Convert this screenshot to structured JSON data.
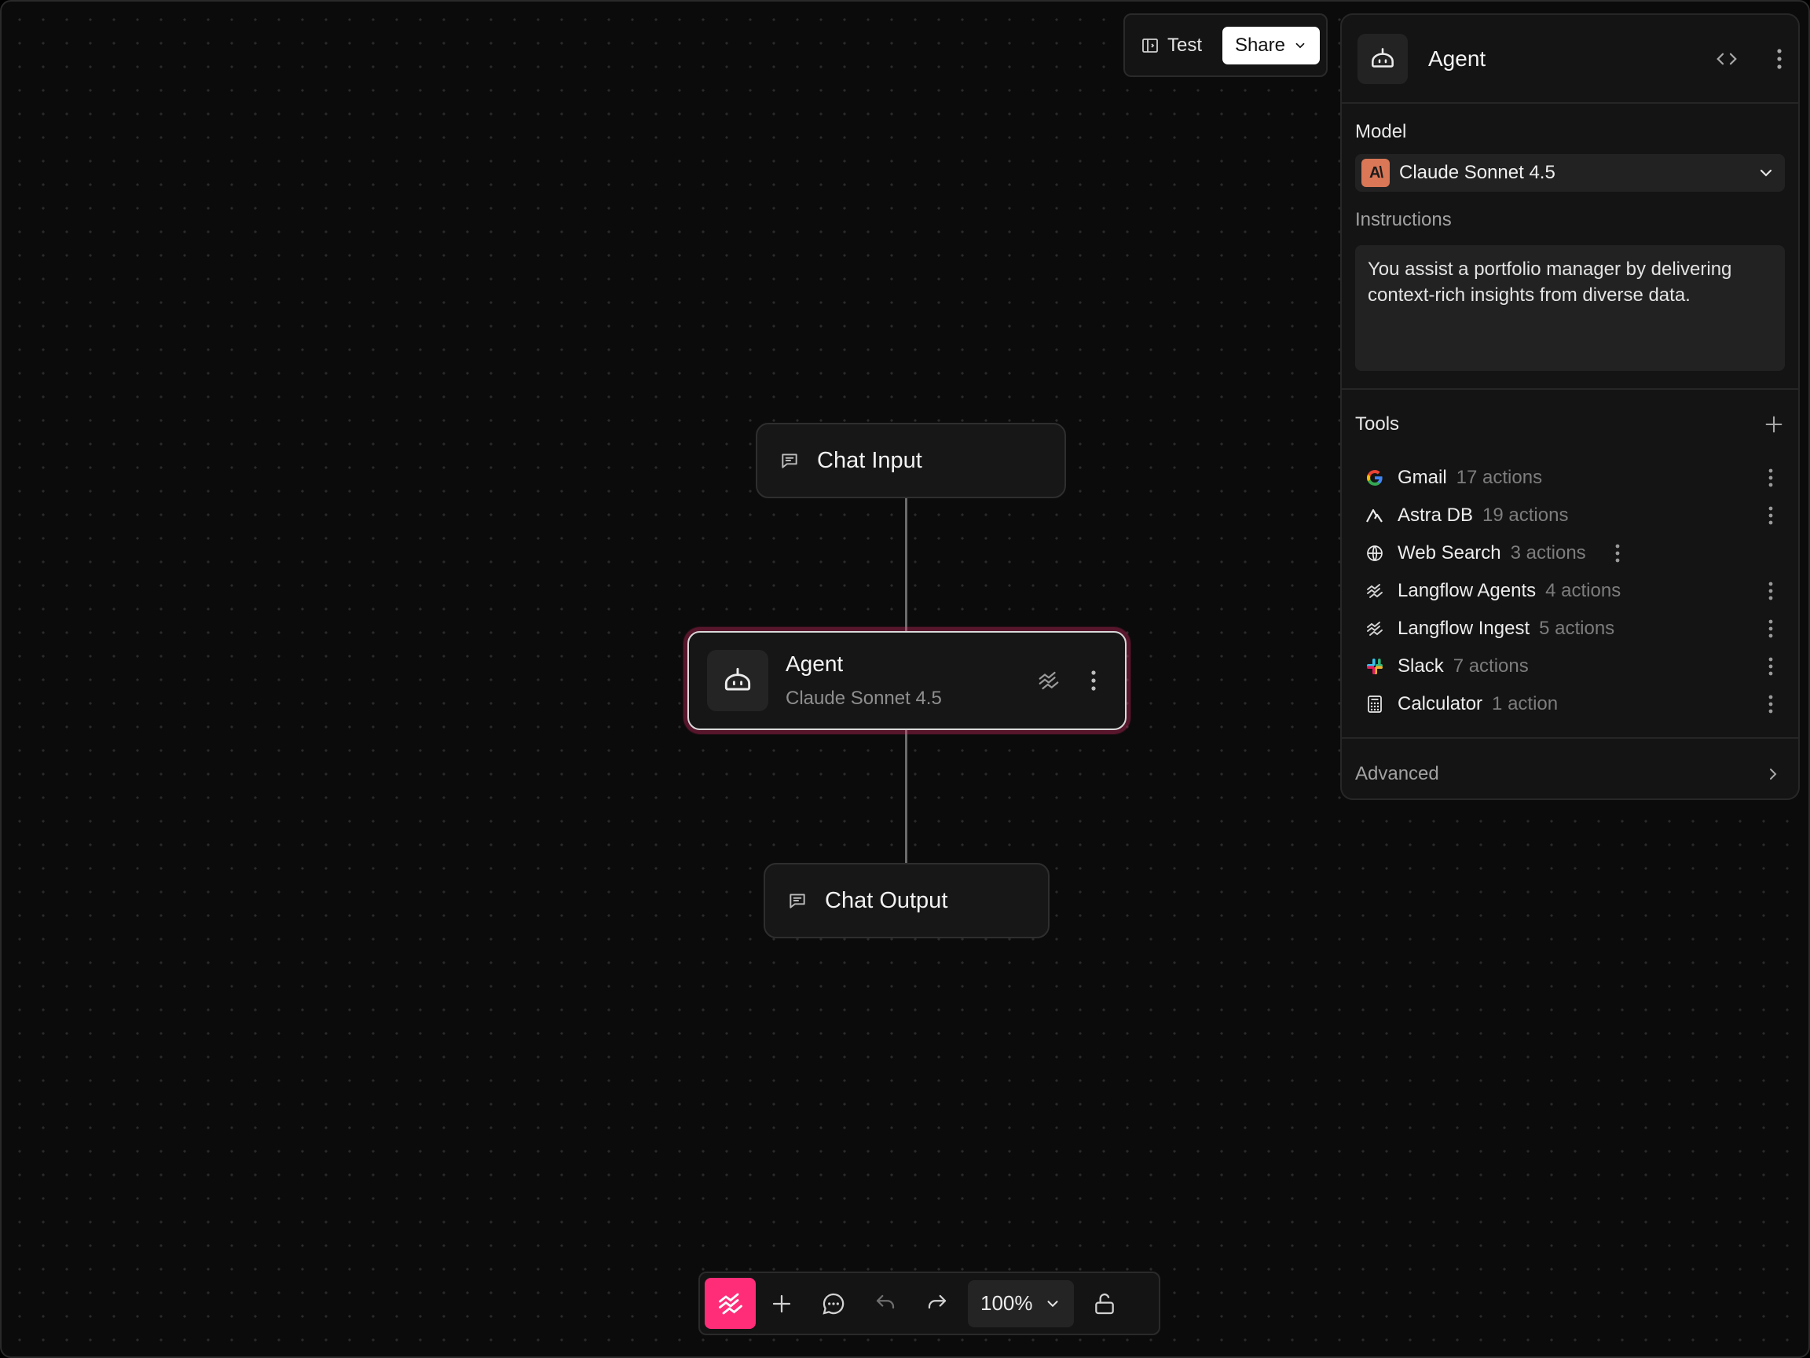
{
  "toolbar_top": {
    "test_label": "Test",
    "share_label": "Share"
  },
  "flow": {
    "chat_input": {
      "title": "Chat Input"
    },
    "agent": {
      "title": "Agent",
      "subtitle": "Claude Sonnet 4.5"
    },
    "chat_output": {
      "title": "Chat Output"
    }
  },
  "panel": {
    "title": "Agent",
    "model_label": "Model",
    "model_value": "Claude Sonnet 4.5",
    "model_logo_text": "A\\",
    "instructions_label": "Instructions",
    "instructions_value": "You assist a portfolio manager by delivering context-rich insights from diverse data.",
    "tools_label": "Tools",
    "tools": [
      {
        "name": "Gmail",
        "count": "17 actions",
        "icon": "google-icon"
      },
      {
        "name": "Astra DB",
        "count": "19 actions",
        "icon": "astra-icon"
      },
      {
        "name": "Web Search",
        "count": "3 actions",
        "icon": "globe-icon"
      },
      {
        "name": "Langflow Agents",
        "count": "4 actions",
        "icon": "langflow-icon"
      },
      {
        "name": "Langflow Ingest",
        "count": "5 actions",
        "icon": "langflow-icon"
      },
      {
        "name": "Slack",
        "count": "7 actions",
        "icon": "slack-icon"
      },
      {
        "name": "Calculator",
        "count": "1 action",
        "icon": "calculator-icon"
      }
    ],
    "advanced_label": "Advanced"
  },
  "toolbar_bottom": {
    "zoom": "100%"
  },
  "colors": {
    "brand": "#ff2d78",
    "anthropic": "#d97757",
    "panel_bg": "#141414",
    "canvas_bg": "#0b0b0b"
  }
}
